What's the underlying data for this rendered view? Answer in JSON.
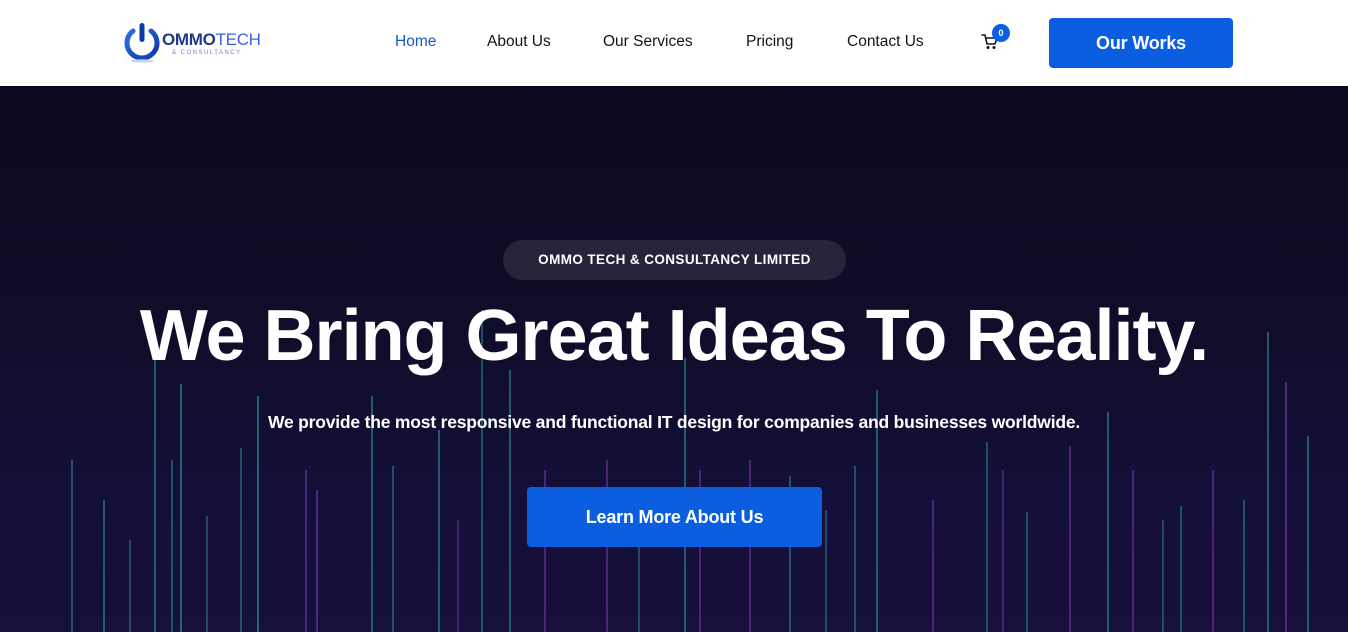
{
  "header": {
    "logo": {
      "word_primary": "OMMO",
      "word_secondary": "TECH",
      "tagline": "& CONSULTANCY",
      "icon": "power-icon"
    },
    "nav": [
      {
        "label": "Home",
        "active": true
      },
      {
        "label": "About Us",
        "active": false
      },
      {
        "label": "Our Services",
        "active": false
      },
      {
        "label": "Pricing",
        "active": false
      },
      {
        "label": "Contact Us",
        "active": false
      }
    ],
    "cart": {
      "icon": "cart-icon",
      "count": "0"
    },
    "cta_label": "Our Works"
  },
  "hero": {
    "badge": "OMMO TECH & CONSULTANCY LIMITED",
    "title": "We Bring Great Ideas To Reality.",
    "subtitle": "We provide the most responsive and functional IT design for companies and businesses worldwide.",
    "cta_label": "Learn More About Us"
  },
  "colors": {
    "accent": "#0b5ee0",
    "nav_active": "#1558c9",
    "hero_bg": "#0c0a1f",
    "badge_bg": "#25243a",
    "line_teal": "#2fa7a8",
    "line_purple": "#8a3fd1"
  }
}
